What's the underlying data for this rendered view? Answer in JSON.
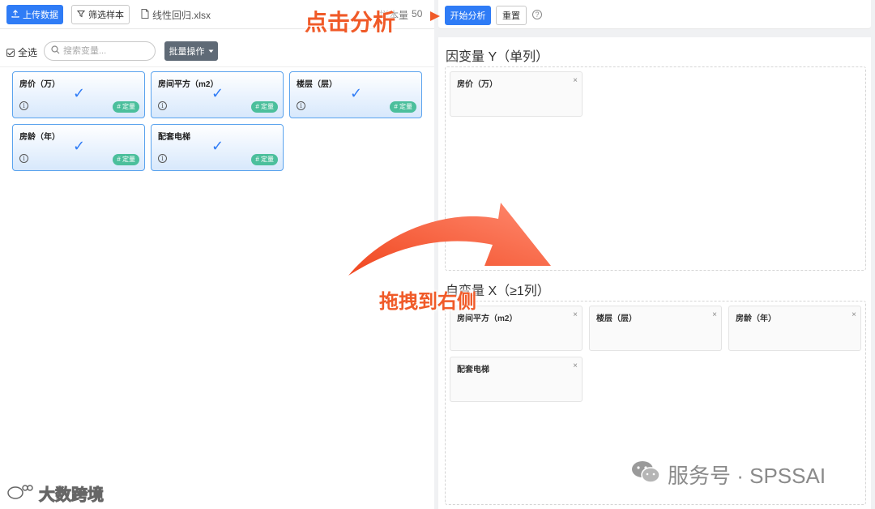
{
  "toolbar_left": {
    "upload_label": "上传数据",
    "filter_label": "筛选样本",
    "file_name": "线性回归.xlsx",
    "sample_label": "样本量",
    "sample_count": "50"
  },
  "variables": {
    "select_all_label": "全选",
    "search_placeholder": "搜索变量...",
    "batch_label": "批量操作",
    "tag_label": "# 定量",
    "info_glyph": "i",
    "check_glyph": "✓",
    "items": [
      {
        "name": "房价（万）"
      },
      {
        "name": "房间平方（m2）"
      },
      {
        "name": "楼层（层）"
      },
      {
        "name": "房龄（年）"
      },
      {
        "name": "配套电梯"
      }
    ]
  },
  "toolbar_right": {
    "start_label": "开始分析",
    "reset_label": "重置",
    "help_glyph": "?"
  },
  "dependent": {
    "title": "因变量 Y（单列）",
    "items": [
      "房价（万）"
    ]
  },
  "independent": {
    "title": "自变量 X（≥1列）",
    "items": [
      "房间平方（m2）",
      "楼层（层）",
      "房龄（年）",
      "配套电梯"
    ]
  },
  "close_glyph": "×",
  "annotations": {
    "click_analyze": "点击分析",
    "drag_right": "拖拽到右侧"
  },
  "watermarks": {
    "left": "大数跨境",
    "right": "服务号 · SPSSAI"
  },
  "colors": {
    "primary": "#2f7cf6",
    "tag": "#4bbf9c",
    "annotation": "#f05a28",
    "card_border": "#5aa3ee"
  }
}
